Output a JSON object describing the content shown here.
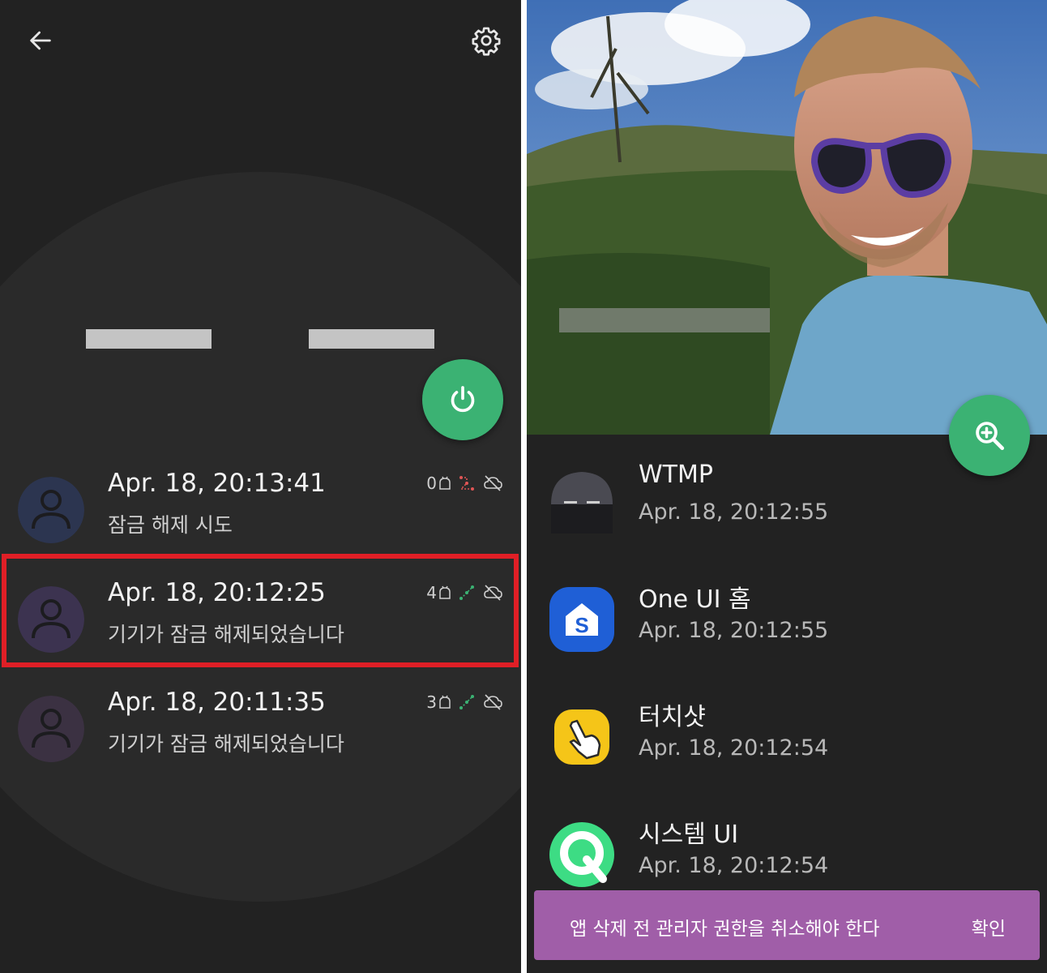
{
  "left": {
    "header": {
      "back_icon": "arrow-left-icon",
      "settings_icon": "gear-icon"
    },
    "power_icon": "power-icon",
    "logs": [
      {
        "time": "Apr. 18, 20:13:41",
        "message": "잠금 해제 시도",
        "count": "0",
        "status_color": "#e05555",
        "avatar_color": "#2c3550"
      },
      {
        "time": "Apr. 18, 20:12:25",
        "message": "기기가 잠금 해제되었습니다",
        "count": "4",
        "status_color": "#3bb273",
        "avatar_color": "#3c3350"
      },
      {
        "time": "Apr. 18, 20:11:35",
        "message": "기기가 잠금 해제되었습니다",
        "count": "3",
        "status_color": "#3bb273",
        "avatar_color": "#3b3142"
      }
    ],
    "highlight_color": "#e01f26"
  },
  "right": {
    "zoom_icon": "zoom-in-icon",
    "apps": [
      {
        "name": "WTMP",
        "time": "Apr. 18, 20:12:55",
        "icon": "wtmp-app-icon"
      },
      {
        "name": "One UI 홈",
        "time": "Apr. 18, 20:12:55",
        "icon": "one-ui-home-icon"
      },
      {
        "name": "터치샷",
        "time": "Apr. 18, 20:12:54",
        "icon": "touchshot-icon"
      },
      {
        "name": "시스템 UI",
        "time": "Apr. 18, 20:12:54",
        "icon": "system-ui-icon"
      }
    ],
    "snackbar": {
      "message": "앱 삭제 전 관리자 권한을 취소해야 한다",
      "action": "확인"
    }
  },
  "colors": {
    "background": "#222222",
    "accent_green": "#3bb273",
    "snackbar_purple": "#a05ea8"
  }
}
